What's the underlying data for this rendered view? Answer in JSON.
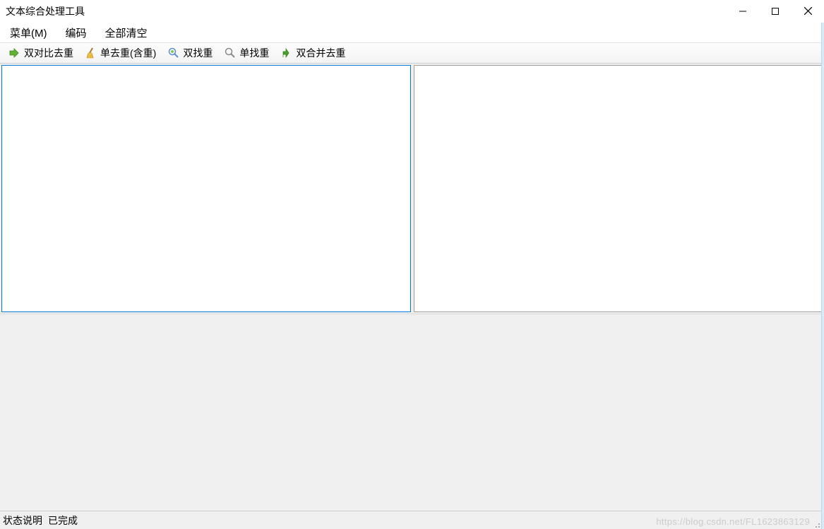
{
  "window": {
    "title": "文本综合处理工具"
  },
  "menubar": {
    "items": [
      {
        "label": "菜单(M)"
      },
      {
        "label": "编码"
      },
      {
        "label": "全部清空"
      }
    ]
  },
  "toolbar": {
    "items": [
      {
        "label": "双对比去重",
        "icon": "compare-icon"
      },
      {
        "label": "单去重(含重)",
        "icon": "broom-icon"
      },
      {
        "label": "双找重",
        "icon": "search-dual-icon"
      },
      {
        "label": "单找重",
        "icon": "search-single-icon"
      },
      {
        "label": "双合并去重",
        "icon": "merge-icon"
      }
    ]
  },
  "panes": {
    "left_value": "",
    "right_value": ""
  },
  "statusbar": {
    "label": "状态说明",
    "value": "已完成"
  },
  "watermark": "https://blog.csdn.net/FL1623863129"
}
